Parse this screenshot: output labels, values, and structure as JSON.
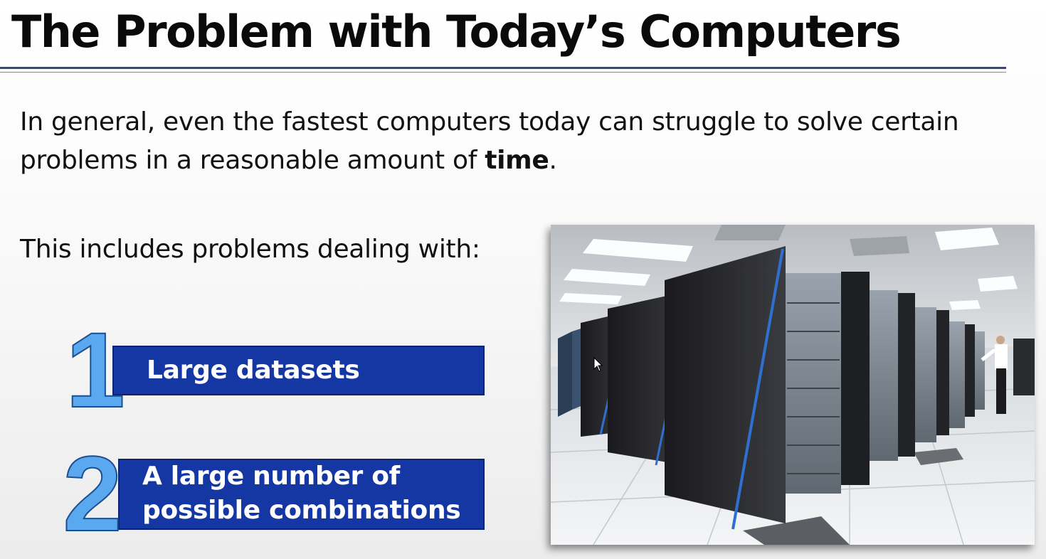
{
  "slide": {
    "title": "The Problem with Today’s Computers",
    "intro_text": "In general, even the fastest computers today can struggle to solve certain problems in a reasonable amount of ",
    "intro_bold": "time",
    "intro_end": ".",
    "includes_text": "This includes problems dealing with:",
    "items": [
      {
        "number": "1",
        "label": "Large datasets"
      },
      {
        "number": "2",
        "label_line1": "A large number of",
        "label_line2": "possible combinations"
      }
    ],
    "photo_icon": "supercomputer-server-room-photo",
    "colors": {
      "accent_bar": "#1437a3",
      "number_fill": "#5aa8ef",
      "rule": "#3a4a6a"
    }
  }
}
